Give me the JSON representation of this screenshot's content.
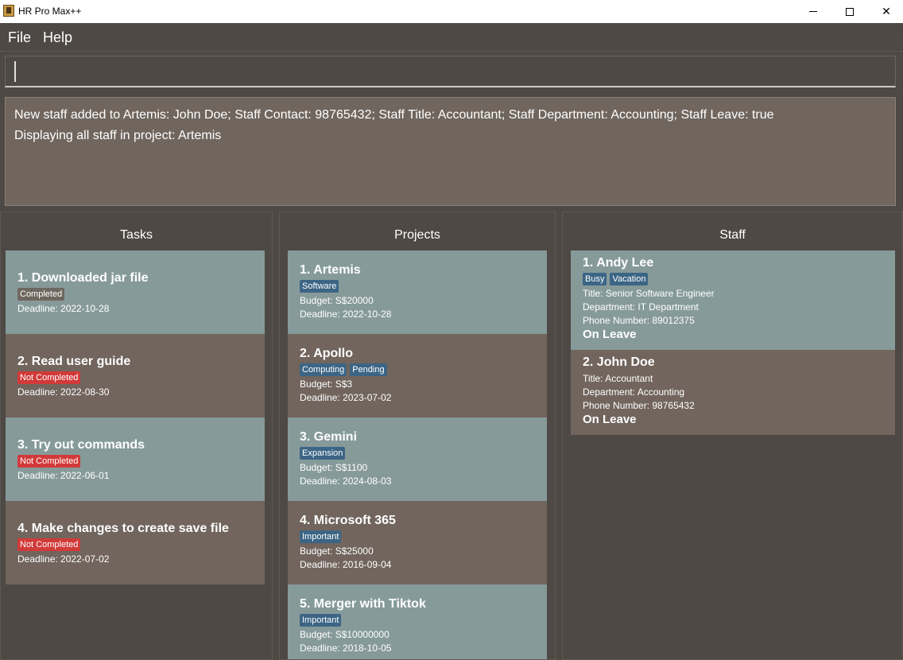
{
  "window": {
    "title": "HR Pro Max++"
  },
  "menu": {
    "file": "File",
    "help": "Help"
  },
  "command": {
    "value": ""
  },
  "result": {
    "lines": [
      "New staff added to Artemis: John Doe; Staff Contact: 98765432; Staff Title: Accountant; Staff Department: Accounting; Staff Leave: true",
      "Displaying all staff in project: Artemis"
    ]
  },
  "tasks": {
    "title": "Tasks",
    "items": [
      {
        "name": "1.  Downloaded jar file",
        "status": "Completed",
        "deadline": "Deadline: 2022-10-28"
      },
      {
        "name": "2.  Read user guide",
        "status": "Not Completed",
        "deadline": "Deadline: 2022-08-30"
      },
      {
        "name": "3.  Try out commands",
        "status": "Not Completed",
        "deadline": "Deadline: 2022-06-01"
      },
      {
        "name": "4.  Make changes to create save file",
        "status": "Not Completed",
        "deadline": "Deadline: 2022-07-02"
      }
    ]
  },
  "projects": {
    "title": "Projects",
    "items": [
      {
        "name": "1.  Artemis",
        "tags": [
          "Software"
        ],
        "budget": "Budget: S$20000",
        "deadline": "Deadline: 2022-10-28"
      },
      {
        "name": "2.  Apollo",
        "tags": [
          "Computing",
          "Pending"
        ],
        "budget": "Budget: S$3",
        "deadline": "Deadline: 2023-07-02"
      },
      {
        "name": "3.  Gemini",
        "tags": [
          "Expansion"
        ],
        "budget": "Budget: S$1100",
        "deadline": "Deadline: 2024-08-03"
      },
      {
        "name": "4.  Microsoft 365",
        "tags": [
          "Important"
        ],
        "budget": "Budget: S$25000",
        "deadline": "Deadline: 2016-09-04"
      },
      {
        "name": "5.  Merger with Tiktok",
        "tags": [
          "Important"
        ],
        "budget": "Budget: S$10000000",
        "deadline": "Deadline: 2018-10-05"
      }
    ]
  },
  "staff": {
    "title": "Staff",
    "items": [
      {
        "name": "1.  Andy Lee",
        "tags": [
          "Busy",
          "Vacation"
        ],
        "title": "Title: Senior Software Engineer",
        "department": "Department: IT Department",
        "phone": "Phone Number: 89012375",
        "leave": "On Leave"
      },
      {
        "name": "2.  John Doe",
        "tags": [],
        "title": "Title: Accountant",
        "department": "Department: Accounting",
        "phone": "Phone Number: 98765432",
        "leave": "On Leave"
      }
    ]
  },
  "colors": {
    "background": "#4e4944",
    "card_light": "#879a9a",
    "card_dark": "#71655d",
    "tag_blue": "#3c6585",
    "tag_red": "#d23a3a",
    "tag_gray": "#6e675f"
  }
}
